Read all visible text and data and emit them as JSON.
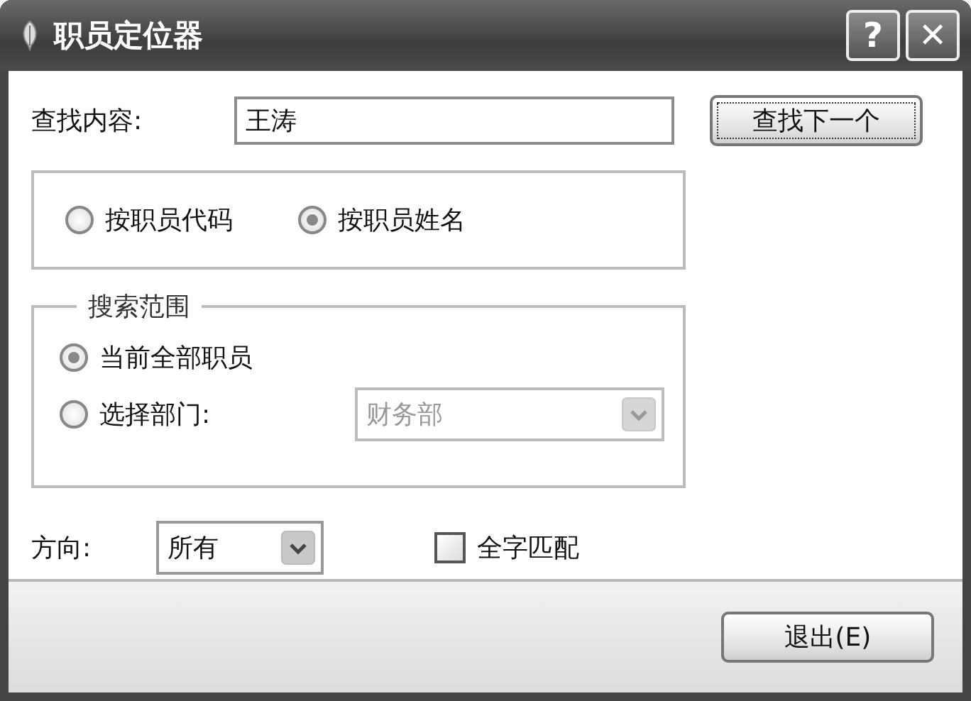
{
  "window": {
    "title": "职员定位器",
    "buttons": [
      {
        "kind": "help",
        "label": "?"
      },
      {
        "kind": "close",
        "label": "✕"
      }
    ]
  },
  "search": {
    "label": "查找内容:",
    "value": "王涛"
  },
  "find_next_button": {
    "label": "查找下一个",
    "focused": true
  },
  "search_by": [
    {
      "label": "按职员代码",
      "selected": false
    },
    {
      "label": "按职员姓名",
      "selected": true
    }
  ],
  "scope": {
    "title": "搜索范围",
    "options": [
      {
        "kind": "plain",
        "label": "当前全部职员",
        "selected": true
      },
      {
        "kind": "department",
        "label": "选择部门:",
        "selected": false
      }
    ],
    "department": {
      "value": "财务部",
      "disabled": true
    }
  },
  "direction": {
    "label": "方向:",
    "value": "所有"
  },
  "whole_word": {
    "label": "全字匹配",
    "checked": false
  },
  "exit_button": {
    "label": "退出(E)"
  }
}
